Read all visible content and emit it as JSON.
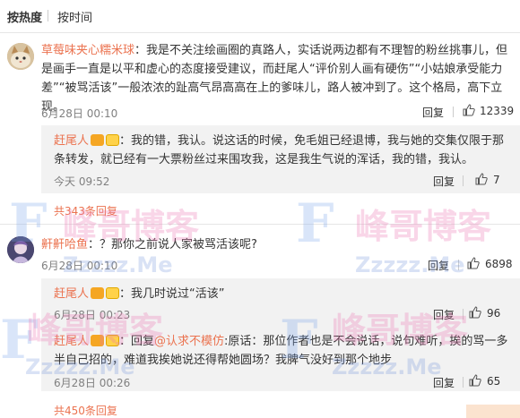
{
  "sort": {
    "hot": "按热度",
    "time": "按时间"
  },
  "comment1": {
    "user": "草莓味夹心糯米球",
    "text": "：我是不关注绘画圈的真路人，实话说两边都有不理智的粉丝挑事儿，但是画手一直是以平和虚心的态度接受建议，而赶尾人“评价别人画有硬伤”“小姑娘承受能力差”“被骂活该”一般浓浓的趾高气昂高高在上的爹味儿，路人被冲到了。这个格局，高下立现。",
    "time": "6月28日 00:10",
    "reply_label": "回复",
    "likes": "12339"
  },
  "reply1": {
    "user": "赶尾人",
    "text": "：我的错，我认。说这话的时候，免毛姐已经退博，我与她的交集仅限于那条转发，就已经有一大票粉丝过来围攻我，这是我生气说的浑话，我的错，我认。",
    "time": "今天 09:52",
    "reply_label": "回复",
    "likes": "7"
  },
  "more1": "共343条回复",
  "comment2": {
    "user": "鼾鼾哈鱼",
    "text": "：？那你之前说人家被骂活该呢?",
    "time": "6月28日 00:10",
    "reply_label": "回复",
    "likes": "6898"
  },
  "reply2": {
    "user": "赶尾人",
    "text": "：我几时说过“活该”",
    "time": "6月28日 00:23",
    "reply_label": "回复",
    "likes": "96"
  },
  "reply3": {
    "user": "赶尾人",
    "prefix": "：回复",
    "mention": "@认求不模仿",
    "text": ":原话：那位作者也是不会说话，说句难听，挨的骂一多半自己招的，难道我挨她说还得帮她圆场？我脾气没好到那个地步",
    "time": "6月28日 00:26",
    "reply_label": "回复",
    "likes": "65"
  },
  "more2": "共450条回复",
  "watermark": {
    "brand_cn": "峰哥博客",
    "letter": "F",
    "domain_text": "Zzzzz.Me"
  },
  "colors": {
    "username": "#eb7350",
    "text": "#333333",
    "muted": "#808080",
    "reply_bg": "#f2f2f2"
  }
}
